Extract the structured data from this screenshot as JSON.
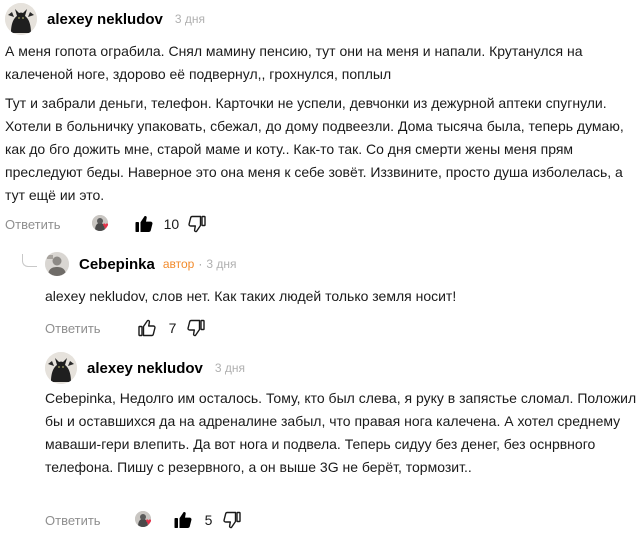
{
  "comments": [
    {
      "author": "alexey nekludov",
      "badge": "",
      "time": "3 дня",
      "paragraphs": [
        "А меня гопота ограбила. Снял мамину пенсию, тут они на меня и напали. Крутанулся на калеченой ноге, здорово её подвернул,, грохнулся, поплыл",
        "Тут и забрали деньги, телефон. Карточки не успели, девчонки из дежурной аптеки спугнули. Хотели в больничку упаковать, сбежал, до дому подвеезли. Дома тысяча была, теперь думаю, как до бго дожить мне, старой маме и коту.. Как-то так. Со дня смерти жены меня прям преследуют беды. Наверное это она меня к себе зовёт. Иззвините, просто душа изболелась, а тут ещё ии это."
      ],
      "reply_label": "Ответить",
      "likes": "10",
      "has_reactors": true,
      "liked": true
    },
    {
      "author": "Cebepinka",
      "badge": "автор",
      "dot": "·",
      "time": "3 дня",
      "paragraphs": [
        "alexey nekludov, слов нет. Как таких людей только земля носит!"
      ],
      "reply_label": "Ответить",
      "likes": "7",
      "has_reactors": false,
      "liked": false
    },
    {
      "author": "alexey nekludov",
      "badge": "",
      "time": "3 дня",
      "paragraphs": [
        "Cebepinka, Недолго им осталось. Тому, кто был слева, я руку в запястье сломал. Положил бы и оставшихся да на адреналине забыл, что правая нога калечена. А хотел среднему маваши-гери влепить. Да вот нога и подвела. Теперь сидуу без денег, без оснрвного телефона. Пишу с резервного, а он выше 3G не берёт, тормозит.."
      ],
      "reply_label": "Ответить",
      "likes": "5",
      "has_reactors": true,
      "liked": true
    }
  ],
  "icons": {
    "like": "thumbs-up-icon",
    "dislike": "thumbs-down-icon",
    "heart": "heart-icon"
  },
  "colors": {
    "author_badge": "#f28b2c",
    "meta": "#b0b0b0",
    "reply": "#8f8f8f",
    "heart": "#e3324a"
  },
  "glyphs": {
    "heart": "♥"
  }
}
